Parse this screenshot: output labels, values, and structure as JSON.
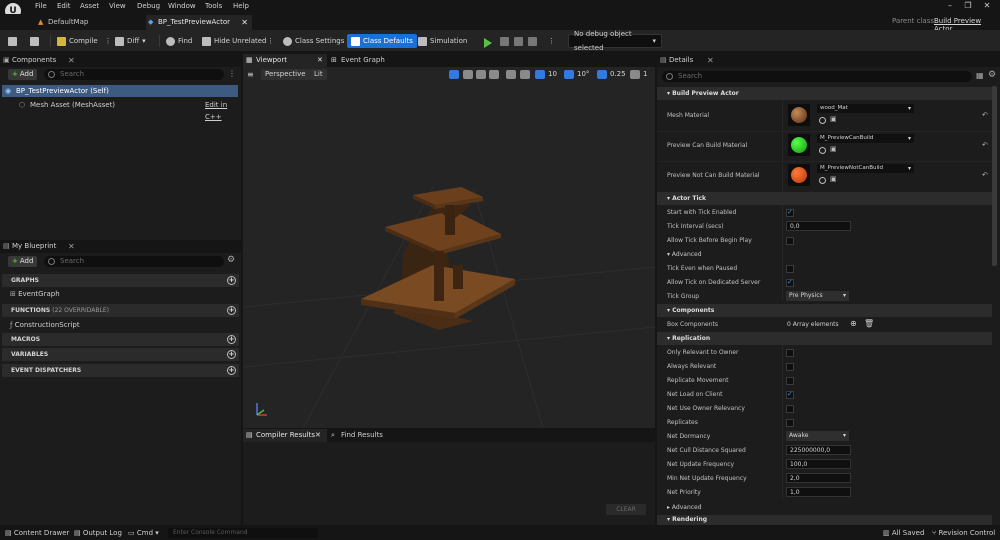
{
  "app": {
    "logo": "U"
  },
  "menu": [
    "File",
    "Edit",
    "Asset",
    "View",
    "Debug",
    "Window",
    "Tools",
    "Help"
  ],
  "tabs": [
    {
      "label": "DefaultMap"
    },
    {
      "label": "BP_TestPreviewActor"
    }
  ],
  "parent_class": {
    "prefix": "Parent class:",
    "name": "Build Preview Actor"
  },
  "toolbar": {
    "compile": "Compile",
    "diff": "Diff",
    "find": "Find",
    "hide_unrelated": "Hide Unrelated",
    "class_settings": "Class Settings",
    "class_defaults": "Class Defaults",
    "simulation": "Simulation",
    "debug_object": "No debug object selected"
  },
  "components": {
    "title": "Components",
    "add": "Add",
    "search_placeholder": "Search",
    "items": [
      "BP_TestPreviewActor (Self)",
      "Mesh Asset (MeshAsset)"
    ],
    "edit_cpp": "Edit in C++"
  },
  "my_blueprint": {
    "title": "My Blueprint",
    "add": "Add",
    "search_placeholder": "Search",
    "graphs": "GRAPHS",
    "event_graph": "EventGraph",
    "functions": "FUNCTIONS",
    "functions_count": "(22 OVERRIDABLE)",
    "construction": "ConstructionScript",
    "macros": "MACROS",
    "variables": "VARIABLES",
    "dispatchers": "EVENT DISPATCHERS"
  },
  "viewport": {
    "tab": "Viewport",
    "event_graph_tab": "Event Graph",
    "perspective": "Perspective",
    "lit": "Lit",
    "grid": "10",
    "angle": "10°",
    "scale": "0.25",
    "camera": "1"
  },
  "bottom": {
    "compiler_tab": "Compiler Results",
    "find_tab": "Find Results",
    "clear": "CLEAR"
  },
  "details": {
    "title": "Details",
    "search_placeholder": "Search",
    "build_preview_actor": "Build Preview Actor",
    "mesh_material": {
      "label": "Mesh Material",
      "value": "wood_Mat",
      "color": "#6b3b1c"
    },
    "preview_can": {
      "label": "Preview Can Build Material",
      "value": "M_PreviewCanBuild",
      "color": "#22c21a"
    },
    "preview_not": {
      "label": "Preview Not Can Build Material",
      "value": "M_PreviewNotCanBuild",
      "color": "#e0500f"
    },
    "actor_tick": "Actor Tick",
    "start_tick": "Start with Tick Enabled",
    "tick_interval": {
      "label": "Tick Interval (secs)",
      "value": "0,0"
    },
    "allow_tick": "Allow Tick Before Begin Play",
    "advanced": "Advanced",
    "tick_paused": "Tick Even when Paused",
    "allow_dedicated": "Allow Tick on Dedicated Server",
    "tick_group": {
      "label": "Tick Group",
      "value": "Pre Physics"
    },
    "components": "Components",
    "box_components": {
      "label": "Box Components",
      "value": "0 Array elements"
    },
    "replication": "Replication",
    "only_relevant": "Only Relevant to Owner",
    "always_relevant": "Always Relevant",
    "replicate_movement": "Replicate Movement",
    "net_load": "Net Load on Client",
    "net_owner": "Net Use Owner Relevancy",
    "replicates": "Replicates",
    "net_dormancy": {
      "label": "Net Dormancy",
      "value": "Awake"
    },
    "net_cull": {
      "label": "Net Cull Distance Squared",
      "value": "225000000,0"
    },
    "net_update": {
      "label": "Net Update Frequency",
      "value": "100,0"
    },
    "min_net_update": {
      "label": "Min Net Update Frequency",
      "value": "2,0"
    },
    "net_priority": {
      "label": "Net Priority",
      "value": "1,0"
    },
    "advanced2": "Advanced",
    "rendering": "Rendering"
  },
  "status": {
    "content_drawer": "Content Drawer",
    "output_log": "Output Log",
    "cmd": "Cmd",
    "console_placeholder": "Enter Console Command",
    "all_saved": "All Saved",
    "revision": "Revision Control"
  }
}
